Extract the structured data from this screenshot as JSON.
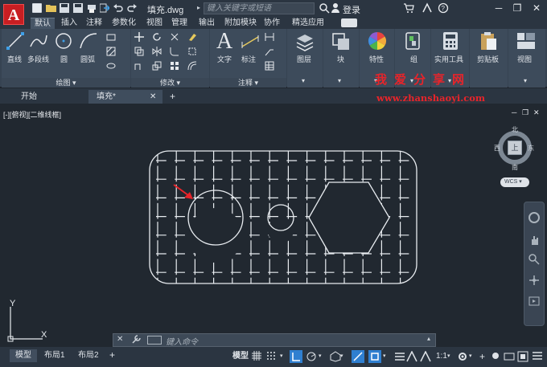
{
  "titlebar": {
    "app_letter": "A",
    "doc_title": "填充.dwg",
    "search_placeholder": "键入关键字或短语",
    "login": "登录",
    "minimize": "─",
    "restore": "❐",
    "close": "✕"
  },
  "ribbon_tabs": [
    "默认",
    "插入",
    "注释",
    "参数化",
    "视图",
    "管理",
    "输出",
    "附加模块",
    "协作",
    "精选应用"
  ],
  "ribbon": {
    "draw": {
      "title": "绘图",
      "line": "直线",
      "polyline": "多段线",
      "circle": "圆",
      "arc": "圆弧"
    },
    "modify": {
      "title": "修改"
    },
    "annotation": {
      "title": "注释",
      "text": "文字",
      "dimension": "标注"
    },
    "layers": {
      "title": "图层"
    },
    "block": {
      "title": "块"
    },
    "properties": {
      "title": "特性"
    },
    "groups": {
      "title": "组"
    },
    "utilities": {
      "title": "实用工具"
    },
    "clipboard": {
      "title": "剪贴板"
    },
    "view": {
      "title": "视图"
    }
  },
  "filetabs": {
    "start": "开始",
    "current": "填充*"
  },
  "viewport": {
    "label": "[-][俯视][二维线框]",
    "compass": {
      "north": "北",
      "south": "南",
      "east": "东",
      "west": "西",
      "top": "上"
    },
    "wcs": "WCS",
    "axis_x": "X",
    "axis_y": "Y"
  },
  "commandline": {
    "placeholder": "键入命令"
  },
  "layout_tabs": [
    "模型",
    "布局1",
    "布局2"
  ],
  "statusbar": {
    "model": "模型",
    "scale": "1:1"
  },
  "watermark": {
    "cn": "我爱分享网",
    "url": "www.zhanshaoyi.com"
  },
  "colors": {
    "accent_red": "#e8242a",
    "drawing_bg": "#212830",
    "ribbon_bg": "#3d4b5b",
    "snap_blue": "#2f7fd0"
  }
}
